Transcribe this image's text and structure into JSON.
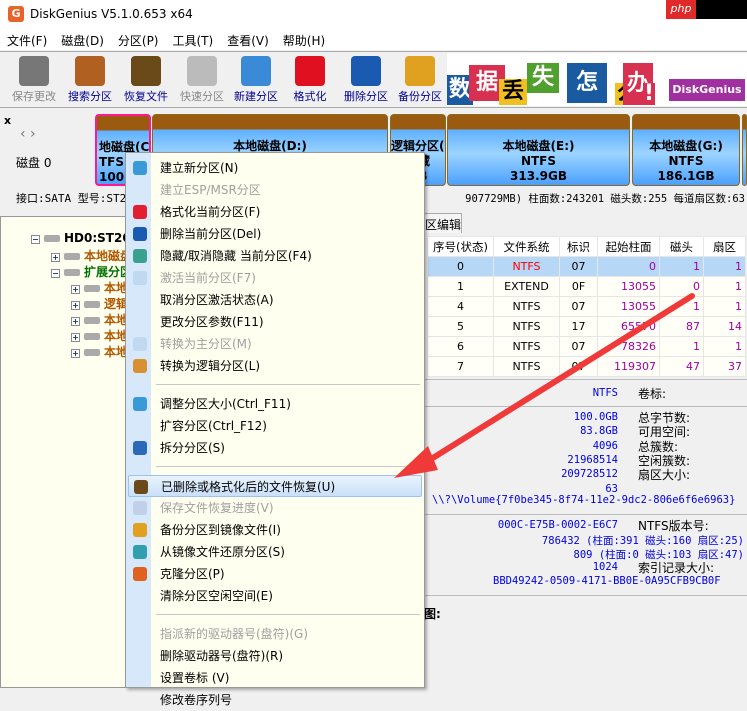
{
  "app": {
    "title": "DiskGenius V5.1.0.653 x64",
    "watermark": "php"
  },
  "menubar": [
    "文件(F)",
    "磁盘(D)",
    "分区(P)",
    "工具(T)",
    "查看(V)",
    "帮助(H)"
  ],
  "toolbar": [
    {
      "label": "保存更改",
      "icon": "save-icon",
      "enabled": false,
      "color": "#777777"
    },
    {
      "label": "搜索分区",
      "icon": "search-icon",
      "enabled": true,
      "color": "#b06020"
    },
    {
      "label": "恢复文件",
      "icon": "recover-icon",
      "enabled": true,
      "color": "#6b4a1a"
    },
    {
      "label": "快速分区",
      "icon": "quick-partition-icon",
      "enabled": false,
      "color": "#bbbbbb"
    },
    {
      "label": "新建分区",
      "icon": "new-partition-icon",
      "enabled": true,
      "color": "#3a8ad8"
    },
    {
      "label": "格式化",
      "icon": "format-icon",
      "enabled": true,
      "color": "#e01020"
    },
    {
      "label": "删除分区",
      "icon": "delete-icon",
      "enabled": true,
      "color": "#1a5ab0"
    },
    {
      "label": "备份分区",
      "icon": "backup-icon",
      "enabled": true,
      "color": "#e0a020"
    }
  ],
  "banner": [
    "数",
    "据",
    "丢",
    "失",
    "怎",
    "么",
    "办",
    "!",
    "DiskGenius"
  ],
  "disk": {
    "nav": "磁盘 0",
    "partitions": [
      {
        "name": "地磁盘(C",
        "fs": "TFS (",
        "size": "100.",
        "selected": true
      },
      {
        "name": "本地磁盘(D:)",
        "fs": "NTFS",
        "size": ""
      },
      {
        "name": "逻辑分区(5",
        "fs": "隐藏",
        "size": "GB"
      },
      {
        "name": "本地磁盘(E:)",
        "fs": "NTFS",
        "size": "313.9GB"
      },
      {
        "name": "本地磁盘(G:)",
        "fs": "NTFS",
        "size": "186.1GB"
      }
    ],
    "info_left": "接口:SATA  型号:ST2",
    "info_right": "907729MB)  柱面数:243201  磁头数:255  每道扇区数:63"
  },
  "tree": [
    {
      "label": "HD0:ST2000DM",
      "color": "#000000",
      "level": 0,
      "sign": "−"
    },
    {
      "label": "本地磁盘(",
      "color": "#b05a00",
      "level": 1,
      "sign": "+"
    },
    {
      "label": "扩展分区",
      "color": "#007000",
      "level": 1,
      "sign": "−"
    },
    {
      "label": "本地磁盘",
      "color": "#b05a00",
      "level": 2,
      "sign": "+"
    },
    {
      "label": "逻辑分",
      "color": "#b05a00",
      "level": 2,
      "sign": "+"
    },
    {
      "label": "本地磁盘",
      "color": "#b05a00",
      "level": 2,
      "sign": "+"
    },
    {
      "label": "本地磁盘",
      "color": "#b05a00",
      "level": 2,
      "sign": "+"
    },
    {
      "label": "本地磁盘",
      "color": "#b05a00",
      "level": 2,
      "sign": "+"
    }
  ],
  "tab": "区编辑",
  "table": {
    "headers": [
      "序号(状态)",
      "文件系统",
      "标识",
      "起始柱面",
      "磁头",
      "扇区"
    ],
    "rows": [
      [
        "0",
        "NTFS",
        "07",
        "0",
        "1",
        "1"
      ],
      [
        "1",
        "EXTEND",
        "0F",
        "13055",
        "0",
        "1"
      ],
      [
        "4",
        "NTFS",
        "07",
        "13055",
        "1",
        "1"
      ],
      [
        "5",
        "NTFS",
        "17",
        "65570",
        "87",
        "14"
      ],
      [
        "6",
        "NTFS",
        "07",
        "78326",
        "1",
        "1"
      ],
      [
        "7",
        "NTFS",
        "07",
        "119307",
        "47",
        "37"
      ]
    ]
  },
  "details": {
    "fs": "NTFS",
    "fs_label": "卷标:",
    "values": [
      "100.0GB",
      "83.8GB",
      "4096",
      "21968514",
      "209728512",
      "63"
    ],
    "labels": [
      "总字节数:",
      "可用空间:",
      "总簇数:",
      "空闲簇数:",
      "扇区大小:"
    ],
    "volume": "\\\\?\\Volume{7f0be345-8f74-11e2-9dc2-806e6f6e6963}",
    "serial": "000C-E75B-0002-E6C7",
    "serial_label": "NTFS版本号:",
    "mft": "786432 (柱面:391 磁头:160 扇区:25)",
    "mftmirr": "809 (柱面:0 磁头:103 扇区:47)",
    "index": "1024",
    "index_label": "索引记录大小:",
    "guid": "BBD49242-0509-4171-BB0E-0A95CFB9CB0F",
    "bottom_label": "图:"
  },
  "context_menu": [
    {
      "label": "建立新分区(N)",
      "icon": "new-partition-icon",
      "enabled": true,
      "color": "#3a9ad8"
    },
    {
      "label": "建立ESP/MSR分区",
      "enabled": false
    },
    {
      "label": "格式化当前分区(F)",
      "icon": "format-icon",
      "enabled": true,
      "color": "#e02030"
    },
    {
      "label": "删除当前分区(Del)",
      "icon": "delete-icon",
      "enabled": true,
      "color": "#1a5ab0"
    },
    {
      "label": "隐藏/取消隐藏 当前分区(F4)",
      "icon": "hide-icon",
      "enabled": true,
      "color": "#3aa090"
    },
    {
      "label": "激活当前分区(F7)",
      "icon": "activate-icon",
      "enabled": false,
      "color": "#c0d8f0"
    },
    {
      "label": "取消分区激活状态(A)",
      "enabled": true
    },
    {
      "label": "更改分区参数(F11)",
      "enabled": true
    },
    {
      "label": "转换为主分区(M)",
      "icon": "convert-primary-icon",
      "enabled": false,
      "color": "#c0d8f0"
    },
    {
      "label": "转换为逻辑分区(L)",
      "icon": "convert-logical-icon",
      "enabled": true,
      "color": "#d89030"
    },
    {
      "sep": true
    },
    {
      "label": "调整分区大小(Ctrl_F11)",
      "icon": "resize-icon",
      "enabled": true,
      "color": "#3a9ad8"
    },
    {
      "label": "扩容分区(Ctrl_F12)",
      "enabled": true
    },
    {
      "label": "拆分分区(S)",
      "icon": "split-icon",
      "enabled": true,
      "color": "#2a6ab8"
    },
    {
      "sep": true
    },
    {
      "label": "已删除或格式化后的文件恢复(U)",
      "icon": "recover-icon",
      "enabled": true,
      "highlighted": true,
      "color": "#6b4a1a"
    },
    {
      "label": "保存文件恢复进度(V)",
      "icon": "save-progress-icon",
      "enabled": false,
      "color": "#c0d0e8"
    },
    {
      "label": "备份分区到镜像文件(I)",
      "icon": "backup-icon",
      "enabled": true,
      "color": "#e0a020"
    },
    {
      "label": "从镜像文件还原分区(S)",
      "icon": "restore-icon",
      "enabled": true,
      "color": "#30a0b0"
    },
    {
      "label": "克隆分区(P)",
      "icon": "clone-icon",
      "enabled": true,
      "color": "#e06020"
    },
    {
      "label": "清除分区空闲空间(E)",
      "enabled": true
    },
    {
      "sep": true
    },
    {
      "label": "指派新的驱动器号(盘符)(G)",
      "enabled": false
    },
    {
      "label": "删除驱动器号(盘符)(R)",
      "enabled": true
    },
    {
      "label": "设置卷标 (V)",
      "enabled": true
    },
    {
      "label": "修改卷序列号",
      "enabled": true
    }
  ],
  "colors": {
    "accent": "#ff1a8c",
    "arrow": "#f03a3a",
    "menu_bg": "#fffff0"
  }
}
